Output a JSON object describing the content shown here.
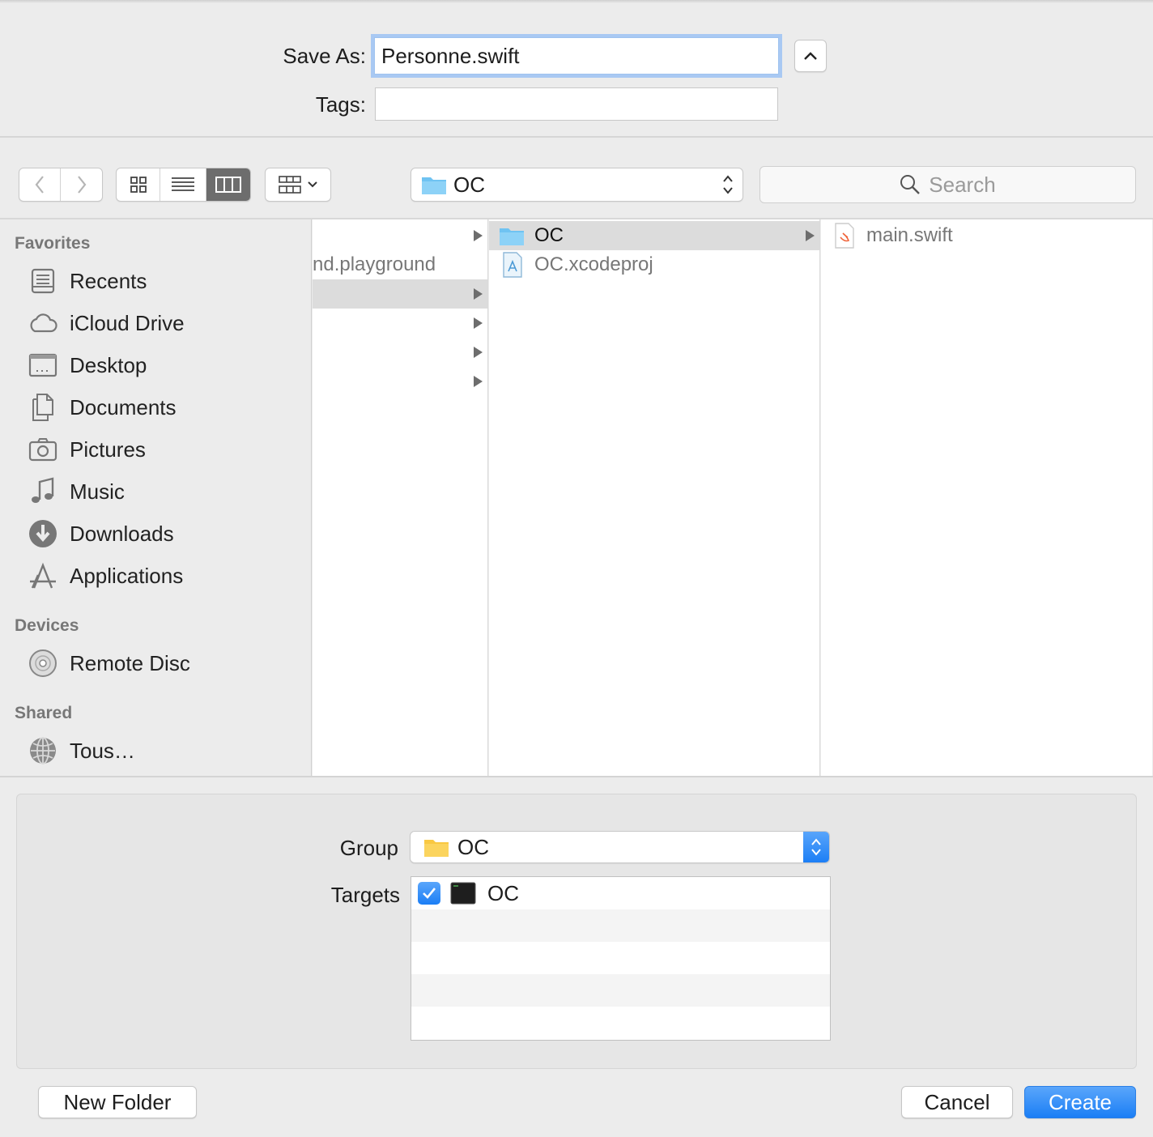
{
  "save_panel": {
    "save_as_label": "Save As:",
    "save_as_value": "Personne.swift",
    "tags_label": "Tags:",
    "tags_value": ""
  },
  "toolbar": {
    "location": "OC",
    "search_placeholder": "Search",
    "view_modes": [
      "icon-view",
      "list-view",
      "column-view"
    ],
    "active_view": "column-view"
  },
  "sidebar": {
    "favorites_header": "Favorites",
    "favorites": [
      {
        "label": "Recents",
        "icon": "recents-icon"
      },
      {
        "label": "iCloud Drive",
        "icon": "cloud-icon"
      },
      {
        "label": "Desktop",
        "icon": "desktop-icon"
      },
      {
        "label": "Documents",
        "icon": "documents-icon"
      },
      {
        "label": "Pictures",
        "icon": "camera-icon"
      },
      {
        "label": "Music",
        "icon": "music-note-icon"
      },
      {
        "label": "Downloads",
        "icon": "download-icon"
      },
      {
        "label": "Applications",
        "icon": "applications-icon"
      }
    ],
    "devices_header": "Devices",
    "devices": [
      {
        "label": "Remote Disc",
        "icon": "disc-icon"
      }
    ],
    "shared_header": "Shared",
    "shared": [
      {
        "label": "Tous…",
        "icon": "network-icon"
      }
    ]
  },
  "columns": {
    "col1": {
      "items": [
        "",
        "nd.playground",
        "",
        "",
        "",
        ""
      ]
    },
    "col2": {
      "items": [
        {
          "label": "OC",
          "icon": "folder-icon",
          "selected": true
        },
        {
          "label": "OC.xcodeproj",
          "icon": "xcodeproj-icon",
          "selected": false
        }
      ]
    },
    "col3": {
      "items": [
        {
          "label": "main.swift",
          "icon": "swift-file-icon"
        }
      ]
    }
  },
  "options": {
    "group_label": "Group",
    "group_value": "OC",
    "targets_label": "Targets",
    "targets": [
      {
        "label": "OC",
        "checked": true
      }
    ]
  },
  "buttons": {
    "new_folder": "New Folder",
    "cancel": "Cancel",
    "create": "Create"
  },
  "colors": {
    "accent": "#1b7ef5",
    "folder_blue": "#6fc3f2",
    "folder_yellow": "#f9c842",
    "focus_ring": "#a9c9f3"
  }
}
